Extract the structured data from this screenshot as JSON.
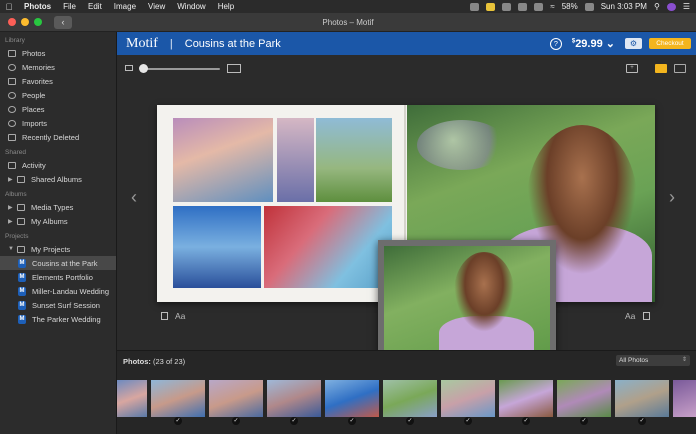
{
  "menubar": {
    "app": "Photos",
    "items": [
      "File",
      "Edit",
      "Image",
      "View",
      "Window",
      "Help"
    ],
    "battery": "58%",
    "clock": "Sun 3:03 PM"
  },
  "window": {
    "title": "Photos – Motif"
  },
  "sidebar": {
    "library_label": "Library",
    "library": [
      "Photos",
      "Memories",
      "Favorites",
      "People",
      "Places",
      "Imports",
      "Recently Deleted"
    ],
    "shared_label": "Shared",
    "shared": [
      "Activity",
      "Shared Albums"
    ],
    "albums_label": "Albums",
    "albums": [
      "Media Types",
      "My Albums"
    ],
    "projects_label": "Projects",
    "my_projects": "My Projects",
    "projects": [
      "Cousins at the Park",
      "Elements Portfolio",
      "Miller-Landau Wedding",
      "Sunset Surf Session",
      "The Parker Wedding"
    ],
    "selected_project": "Cousins at the Park"
  },
  "header": {
    "brand": "Motif",
    "divider": "|",
    "project_title": "Cousins at the Park",
    "help": "?",
    "price_currency": "$",
    "price": "29.99",
    "checkout": "Checkout"
  },
  "editor": {
    "layout_label_left": "Aa",
    "layout_label_right": "Aa"
  },
  "filmstrip": {
    "label": "Photos:",
    "count": "(23 of 23)",
    "filter": "All Photos"
  },
  "colors": {
    "accent_blue": "#1b57a8",
    "checkout_yellow": "#f3b51e"
  }
}
